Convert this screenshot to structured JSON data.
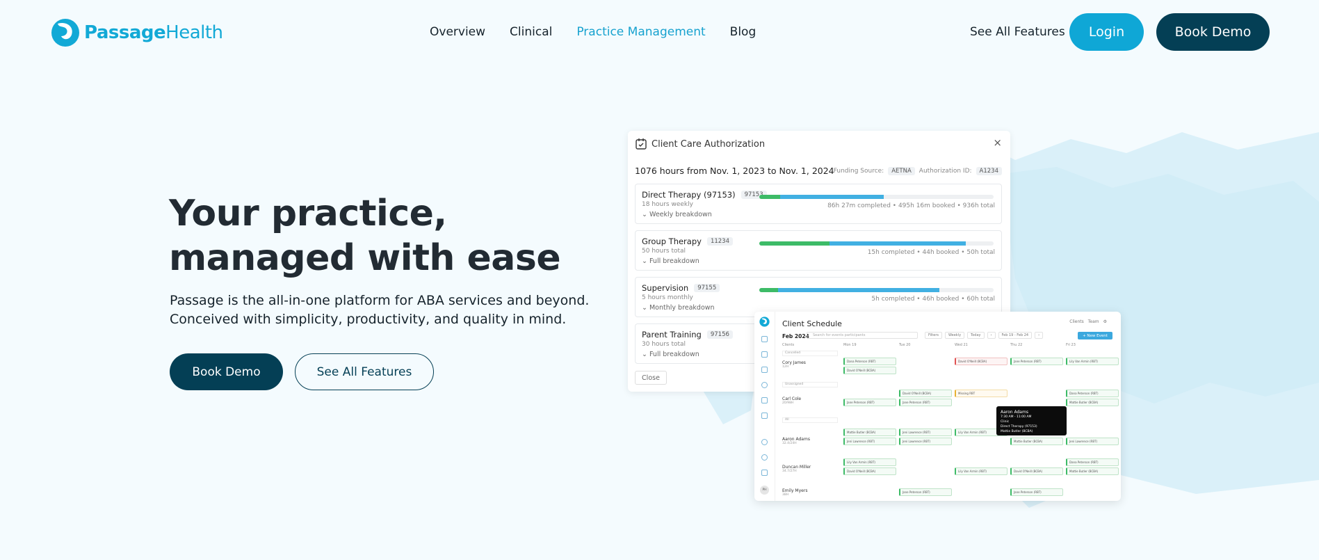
{
  "nav": {
    "logo": {
      "part1": "Passage",
      "part2": "Health"
    },
    "links": [
      "Overview",
      "Clinical",
      "Practice Management",
      "Blog"
    ],
    "active_link": "Practice Management",
    "see_all_features": "See All Features",
    "login": "Login",
    "book_demo": "Book Demo"
  },
  "hero": {
    "title_line1": "Your practice,",
    "title_line2": "managed with ease",
    "subtitle_line1": "Passage is the all-in-one platform for ABA services and beyond.",
    "subtitle_line2": "Conceived with simplicity, productivity, and quality in mind.",
    "book_demo": "Book Demo",
    "see_all_features": "See All Features"
  },
  "auth_card": {
    "title": "Client Care Authorization",
    "close_icon": "×",
    "range": "1076 hours from Nov. 1, 2023 to Nov. 1, 2024",
    "funding_label": "Funding Source:",
    "funding_value": "AETNA",
    "auth_id_label": "Authorization ID:",
    "auth_id_value": "A1234",
    "rows": [
      {
        "name": "Direct Therapy (97153)",
        "code": "97153",
        "sub": "18 hours weekly",
        "expand": "Weekly breakdown",
        "stats": "86h 27m completed • 495h 16m booked • 936h total",
        "completed": 0.09,
        "booked": 0.53
      },
      {
        "name": "Group Therapy",
        "code": "11234",
        "sub": "50 hours total",
        "expand": "Full breakdown",
        "stats": "15h completed • 44h booked • 50h total",
        "completed": 0.3,
        "booked": 0.88
      },
      {
        "name": "Supervision",
        "code": "97155",
        "sub": "5 hours monthly",
        "expand": "Monthly breakdown",
        "stats": "5h completed • 46h booked • 60h total",
        "completed": 0.08,
        "booked": 0.77
      },
      {
        "name": "Parent Training",
        "code": "97156",
        "sub": "30 hours total",
        "expand": "Full breakdown",
        "stats": "",
        "completed": 0,
        "booked": 0
      }
    ],
    "close_button": "Close"
  },
  "schedule": {
    "title": "Client Schedule",
    "tabs": [
      "Clients",
      "Team"
    ],
    "month": "Feb 2024",
    "search_placeholder": "Search for events participants",
    "filters": "Filters",
    "view": "Weekly",
    "today": "Today",
    "range": "Feb 19 - Feb 24",
    "new_event": "+ New Event",
    "col_clients": "Clients",
    "days": [
      "Mon 19",
      "Tue 20",
      "Wed 21",
      "Thu 22",
      "Fri 23"
    ],
    "groups": [
      "Cancelled",
      "Unassigned",
      "All"
    ],
    "clients": [
      {
        "name": "Cory James",
        "sub": "12H"
      },
      {
        "name": "Carl Cole",
        "sub": "20/98H"
      },
      {
        "name": "Aaron Adams",
        "sub": "32.4/24H"
      },
      {
        "name": "Duncan Miller",
        "sub": "34.7/27H"
      },
      {
        "name": "Emily Myers",
        "sub": "38H"
      }
    ],
    "tooltip": {
      "name": "Aaron Adams",
      "time": "7:30 AM - 11:00 AM",
      "lines": [
        "Clinic",
        "Direct Therapy (97153)",
        "Mattie Butler (BCBA)"
      ]
    },
    "events": [
      "Dana Peterson (RBT)",
      "David O'Neill (BCBA)",
      "Jane Peterson (RBT)",
      "Lily Van Armin (RBT)",
      "Jeni Lawrence (RBT)",
      "Mattie Butler (BCBA)",
      "Missing RBT"
    ],
    "avatar": "PH"
  },
  "colors": {
    "primary": "#0fa7d6",
    "dark": "#043f55",
    "bg": "#f4fbfe"
  }
}
